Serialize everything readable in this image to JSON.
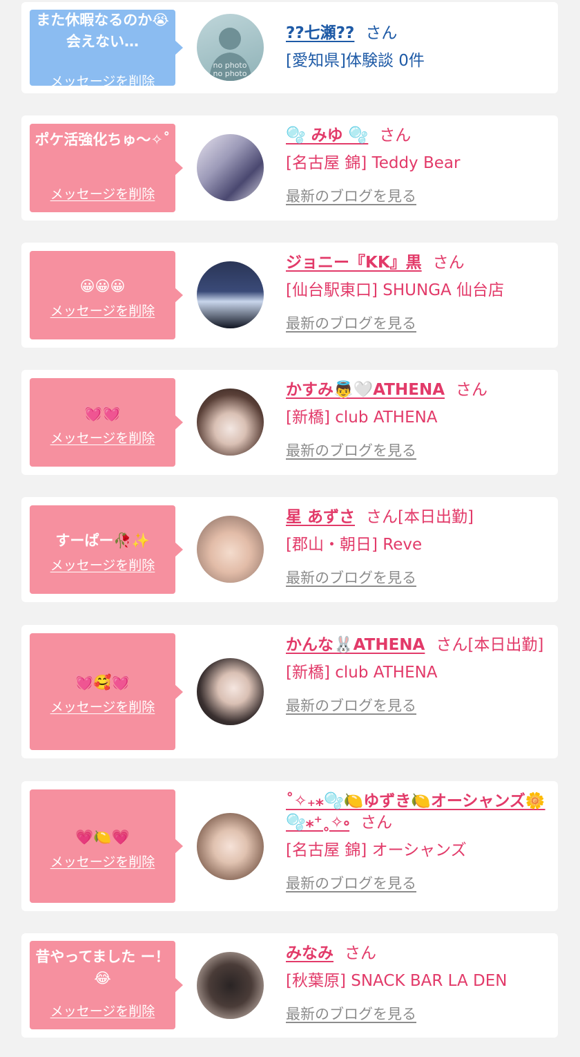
{
  "delete_label": "メッセージを削除",
  "blog_label": "最新のブログを見る",
  "honorific": "さん",
  "colors": {
    "blue_bubble": "#8bbcf1",
    "pink_bubble": "#f6909f",
    "blue_text": "#1e5aa6",
    "pink_text": "#e23a69",
    "link_gray": "#8c8c8c"
  },
  "items": [
    {
      "message": "また休暇なるのか😭会えない…",
      "name": "??七瀬??",
      "status": "",
      "shop": "[愛知県]体験談 0件",
      "bubble_color": "blue",
      "avatar": "no-photo"
    },
    {
      "message": "ポケ活強化ちゅ〜✧˚",
      "name": "🫧 みゆ 🫧",
      "status": "",
      "shop": "[名古屋 錦] Teddy Bear",
      "bubble_color": "pink",
      "avatar": "photo"
    },
    {
      "message": "😀😀😀",
      "name": "ジョニー『KK』黒",
      "status": "",
      "shop": "[仙台駅東口] SHUNGA 仙台店",
      "bubble_color": "pink",
      "avatar": "photo"
    },
    {
      "message": "💓💓",
      "name": "かすみ👼🤍ATHENA",
      "status": "",
      "shop": "[新橋] club ATHENA",
      "bubble_color": "pink",
      "avatar": "photo"
    },
    {
      "message": "すーぱー🥀✨",
      "name": "星 あずさ",
      "status": "[本日出勤]",
      "shop": "[郡山・朝日] Reve",
      "bubble_color": "pink",
      "avatar": "photo"
    },
    {
      "message": "💓🥰💓",
      "name": "かんな🐰ATHENA",
      "status": "[本日出勤]",
      "shop": "[新橋] club ATHENA",
      "bubble_color": "pink",
      "avatar": "photo"
    },
    {
      "message": "💗🍋💗",
      "name": "˚✧₊⁎🫧🍋ゆずき🍋オーシャンズ🌼🫧⁎⁺˳✧༚",
      "status": "",
      "shop": "[名古屋 錦] オーシャンズ",
      "bubble_color": "pink",
      "avatar": "photo"
    },
    {
      "message": "昔やってました ー！😂",
      "name": "みなみ",
      "status": "",
      "shop": "[秋葉原] SNACK BAR LA DEN",
      "bubble_color": "pink",
      "avatar": "photo"
    }
  ]
}
